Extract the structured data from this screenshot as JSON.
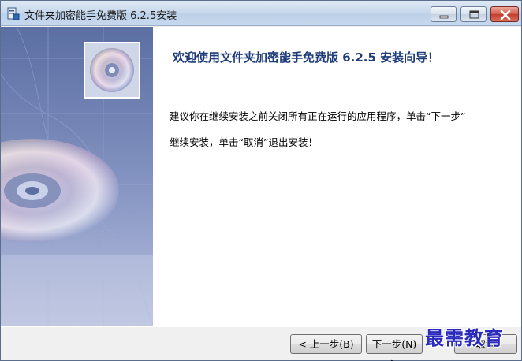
{
  "window": {
    "title": "文件夹加密能手免费版 6.2.5安装"
  },
  "content": {
    "heading": "欢迎使用文件夹加密能手免费版 6.2.5 安装向导！",
    "paragraph_line1": "建议你在继续安装之前关闭所有正在运行的应用程序，单击“下一步”",
    "paragraph_line2": "继续安装，单击“取消”退出安装！"
  },
  "buttons": {
    "back": "< 上一步(B)",
    "next": "下一步(N) >",
    "cancel": "取消"
  },
  "watermark": "最需教育",
  "colors": {
    "heading": "#1f3c7a",
    "banner": "#7182b3",
    "watermark": "#2a2abd"
  }
}
